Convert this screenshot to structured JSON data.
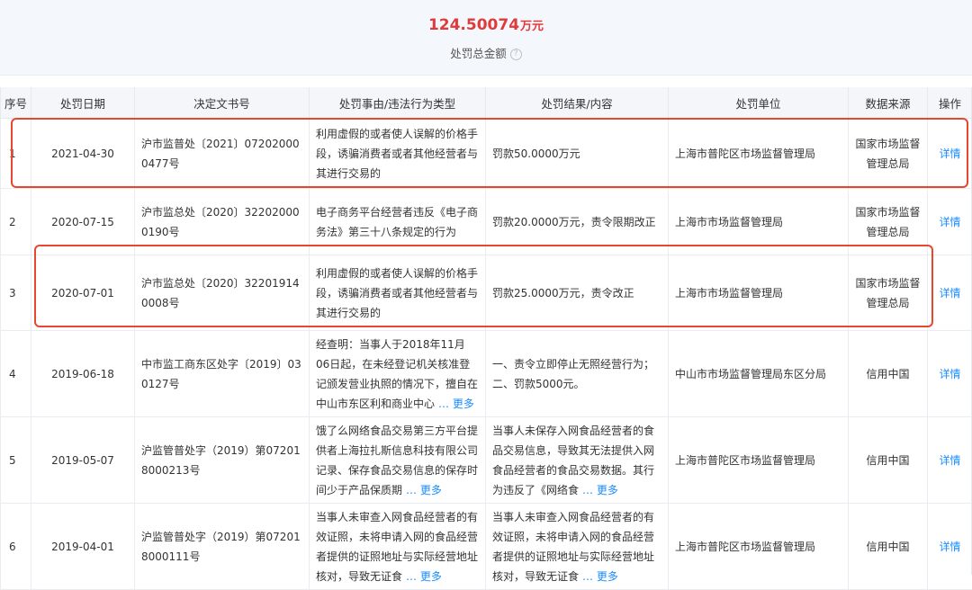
{
  "summary": {
    "amount": "124.50074",
    "unit": "万元",
    "label": "处罚总金额",
    "help_icon": "question-circle-icon"
  },
  "columns": [
    "序号",
    "处罚日期",
    "决定文书号",
    "处罚事由/违法行为类型",
    "处罚结果/内容",
    "处罚单位",
    "数据来源",
    "操作"
  ],
  "rows": [
    {
      "idx": "1",
      "date": "2021-04-30",
      "doc": "沪市监普处〔2021〕072020000477号",
      "reason": "利用虚假的或者使人误解的价格手段，诱骗消费者或者其他经营者与其进行交易的",
      "reason_more": "",
      "result": "罚款50.0000万元",
      "result_more": "",
      "unit": "上海市普陀区市场监督管理局",
      "source": "国家市场监督管理总局",
      "action": "详情"
    },
    {
      "idx": "2",
      "date": "2020-07-15",
      "doc": "沪市监总处〔2020〕322020000190号",
      "reason": "电子商务平台经营者违反《电子商务法》第三十八条规定的行为",
      "reason_more": "",
      "result": "罚款20.0000万元，责令限期改正",
      "result_more": "",
      "unit": "上海市市场监督管理局",
      "source": "国家市场监督管理总局",
      "action": "详情"
    },
    {
      "idx": "3",
      "date": "2020-07-01",
      "doc": "沪市监总处〔2020〕322019140008号",
      "reason": "利用虚假的或者使人误解的价格手段，诱骗消费者或者其他经营者与其进行交易的",
      "reason_more": "",
      "result": "罚款25.0000万元，责令改正",
      "result_more": "",
      "unit": "上海市市场监督管理局",
      "source": "国家市场监督管理总局",
      "action": "详情"
    },
    {
      "idx": "4",
      "date": "2019-06-18",
      "doc": "中市监工商东区处字〔2019〕030127号",
      "reason": "经查明：当事人于2018年11月06日起，在未经登记机关核准登记颁发营业执照的情况下，擅自在中山市东区利和商业中心",
      "reason_more": "… 更多",
      "result": "一、责令立即停止无照经营行为；二、罚款5000元。",
      "result_more": "",
      "unit": "中山市市场监督管理局东区分局",
      "source": "信用中国",
      "action": "详情"
    },
    {
      "idx": "5",
      "date": "2019-05-07",
      "doc": "沪监管普处字（2019）第072018000213号",
      "reason": "饿了么网络食品交易第三方平台提供者上海拉扎斯信息科技有限公司记录、保存食品交易信息的保存时间少于产品保质期",
      "reason_more": "… 更多",
      "result": "当事人未保存入网食品经营者的食品交易信息，导致其无法提供入网食品经营者的食品交易数据。其行为违反了《网络食",
      "result_more": "… 更多",
      "unit": "上海市普陀区市场监督管理局",
      "source": "信用中国",
      "action": "详情"
    },
    {
      "idx": "6",
      "date": "2019-04-01",
      "doc": "沪监管普处字（2019）第072018000111号",
      "reason": "当事人未审查入网食品经营者的有效证照，未将申请入网的食品经营者提供的证照地址与实际经营地址核对，导致无证食",
      "reason_more": "… 更多",
      "result": "当事人未审查入网食品经营者的有效证照，未将申请入网的食品经营者提供的证照地址与实际经营地址核对，导致无证食",
      "result_more": "… 更多",
      "unit": "上海市普陀区市场监督管理局",
      "source": "信用中国",
      "action": "详情"
    }
  ],
  "highlight_color": "#e8472f",
  "accent_color": "#1a8cff",
  "amount_color": "#e03a3a"
}
